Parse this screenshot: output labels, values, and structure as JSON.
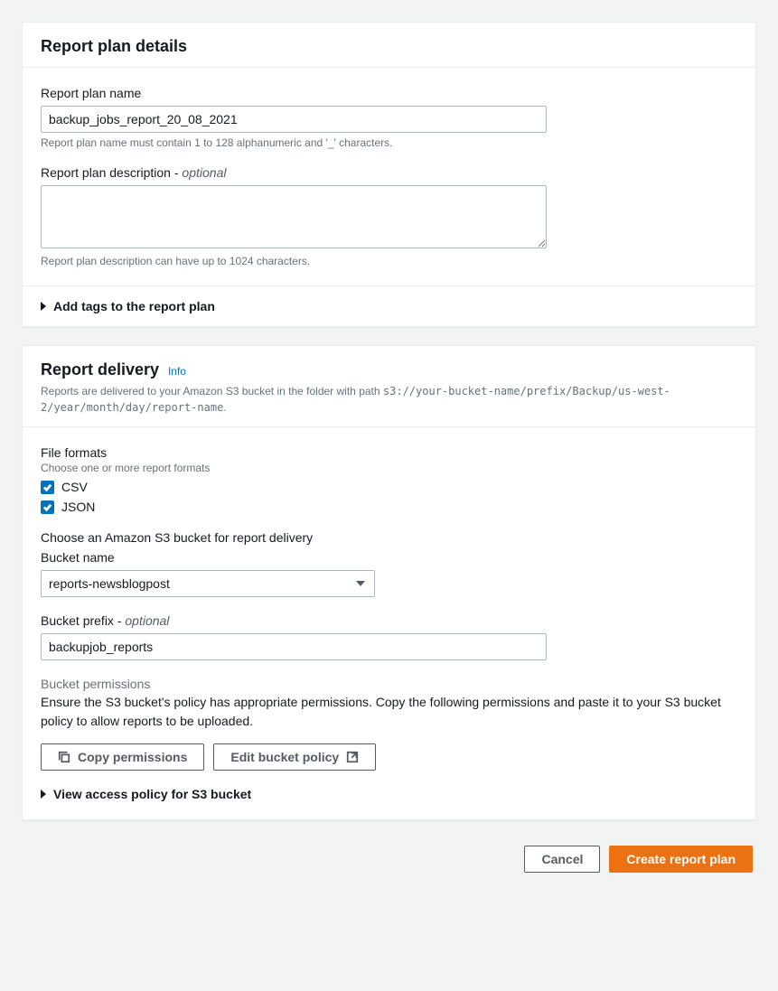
{
  "details": {
    "title": "Report plan details",
    "name_label": "Report plan name",
    "name_value": "backup_jobs_report_20_08_2021",
    "name_help": "Report plan name must contain 1 to 128 alphanumeric and '_' characters.",
    "desc_label": "Report plan description - ",
    "desc_optional": "optional",
    "desc_value": "",
    "desc_help": "Report plan description can have up to 1024 characters.",
    "tags_expand": "Add tags to the report plan"
  },
  "delivery": {
    "title": "Report delivery",
    "info": "Info",
    "subtext_prefix": "Reports are delivered to your Amazon S3 bucket in the folder with path ",
    "subtext_path": "s3://your-bucket-name/prefix/Backup/us-west-2/year/month/day/report-name",
    "formats_label": "File formats",
    "formats_help": "Choose one or more report formats",
    "csv_label": "CSV",
    "json_label": "JSON",
    "s3_heading": "Choose an Amazon S3 bucket for report delivery",
    "bucket_label": "Bucket name",
    "bucket_value": "reports-newsblogpost",
    "prefix_label": "Bucket prefix - ",
    "prefix_optional": "optional",
    "prefix_value": "backupjob_reports",
    "perm_label": "Bucket permissions",
    "perm_text": "Ensure the S3 bucket's policy has appropriate permissions. Copy the following permissions and paste it to your S3 bucket policy to allow reports to be uploaded.",
    "copy_btn": "Copy permissions",
    "edit_btn": "Edit bucket policy",
    "view_policy": "View access policy for S3 bucket"
  },
  "footer": {
    "cancel": "Cancel",
    "create": "Create report plan"
  }
}
